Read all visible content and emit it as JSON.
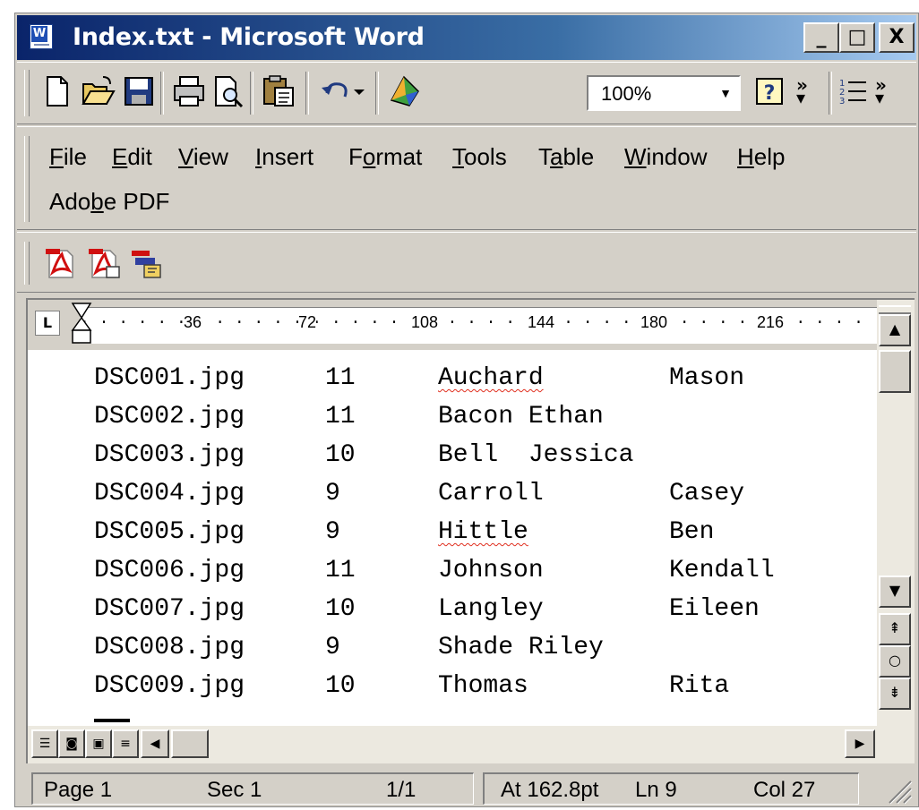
{
  "window": {
    "title": "Index.txt - Microsoft Word"
  },
  "title_buttons": {
    "minimize": "_",
    "maximize": "□",
    "close": "X"
  },
  "toolbar": {
    "zoom": "100%",
    "icons": [
      "new-document-icon",
      "open-folder-icon",
      "save-icon",
      "print-icon",
      "print-preview-icon",
      "paste-icon",
      "undo-icon",
      "drawing-icon",
      "help-icon",
      "numbering-icon"
    ]
  },
  "menu": {
    "items": [
      {
        "pre": "",
        "u": "F",
        "post": "ile"
      },
      {
        "pre": "",
        "u": "E",
        "post": "dit"
      },
      {
        "pre": "",
        "u": "V",
        "post": "iew"
      },
      {
        "pre": "",
        "u": "I",
        "post": "nsert"
      },
      {
        "pre": "F",
        "u": "o",
        "post": "rmat"
      },
      {
        "pre": "",
        "u": "T",
        "post": "ools"
      },
      {
        "pre": "T",
        "u": "a",
        "post": "ble"
      },
      {
        "pre": "",
        "u": "W",
        "post": "indow"
      },
      {
        "pre": "",
        "u": "H",
        "post": "elp"
      },
      {
        "pre": "Ado",
        "u": "b",
        "post": "e PDF"
      }
    ]
  },
  "ruler": {
    "tab_selector": "L",
    "marks": [
      "36",
      "72",
      "108",
      "144",
      "180",
      "216"
    ]
  },
  "document": {
    "rows": [
      {
        "file": "DSC001.jpg",
        "grade": "11",
        "last": "Auchard",
        "first": "Mason"
      },
      {
        "file": "DSC002.jpg",
        "grade": "11",
        "last": "Bacon Ethan",
        "first": ""
      },
      {
        "file": "DSC003.jpg",
        "grade": "10",
        "last": "Bell  Jessica",
        "first": ""
      },
      {
        "file": "DSC004.jpg",
        "grade": "9",
        "last": "Carroll",
        "first": "Casey"
      },
      {
        "file": "DSC005.jpg",
        "grade": "9",
        "last": "Hittle",
        "first": "Ben"
      },
      {
        "file": "DSC006.jpg",
        "grade": "11",
        "last": "Johnson",
        "first": "Kendall"
      },
      {
        "file": "DSC007.jpg",
        "grade": "10",
        "last": "Langley",
        "first": "Eileen"
      },
      {
        "file": "DSC008.jpg",
        "grade": "9",
        "last": "Shade Riley",
        "first": ""
      },
      {
        "file": "DSC009.jpg",
        "grade": "10",
        "last": "Thomas",
        "first": "Rita"
      }
    ]
  },
  "status": {
    "page": "Page 1",
    "sec": "Sec 1",
    "pages": "1/1",
    "at": "At 162.8pt",
    "ln": "Ln 9",
    "col": "Col 27"
  },
  "colors": {
    "title_start": "#0a246a",
    "title_end": "#a6caf0",
    "chrome": "#d4d0c8",
    "spell_error": "#e03020"
  }
}
